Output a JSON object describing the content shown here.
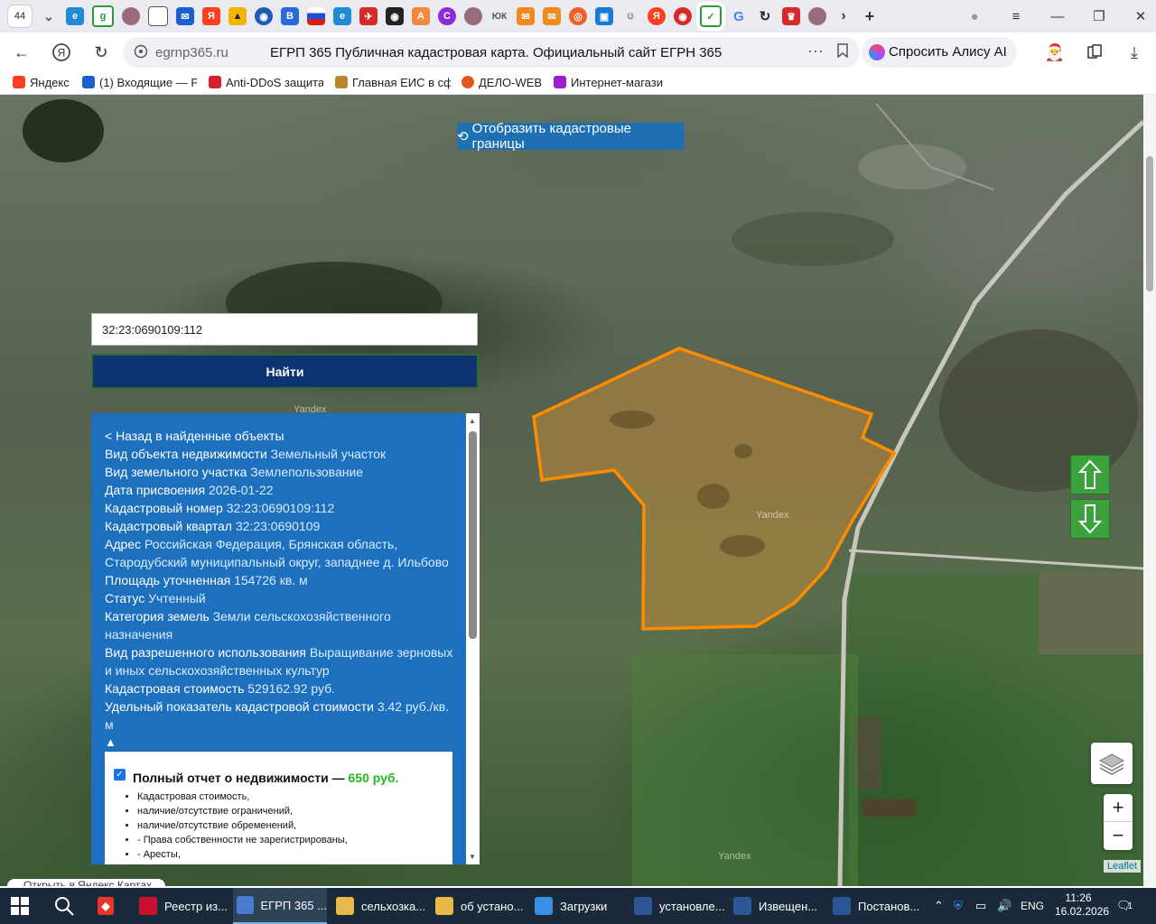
{
  "browser": {
    "tab_count": "44",
    "url_domain": "egrnp365.ru",
    "page_title": "ЕГРП 365 Публичная кадастровая карта. Официальный сайт ЕГРН 365",
    "alice_label": "Спросить Алису AI",
    "bookmarks": [
      {
        "label": "Яндекс",
        "icon": "yandex-icon",
        "color": "#fc3f1d"
      },
      {
        "label": "(1) Входящие — Р",
        "icon": "mail-icon",
        "color": "#1a5fd0"
      },
      {
        "label": "Anti-DDoS защита",
        "icon": "rts-icon",
        "color": "#d4202a"
      },
      {
        "label": "Главная ЕИС в сф",
        "icon": "emblem-icon",
        "color": "#b8862b"
      },
      {
        "label": "ДЕЛО-WEB",
        "icon": "delo-icon",
        "color": "#e05a1f"
      },
      {
        "label": "Интернет-магази",
        "icon": "wb-icon",
        "color": "#a11ad0"
      }
    ]
  },
  "map": {
    "boundaries_button": "Отобразить кадастровые границы",
    "search_value": "32:23:0690109:112",
    "find_button": "Найти",
    "back_link": "< Назад в найденные объекты",
    "properties": [
      {
        "k": "Вид объекта недвижимости",
        "v": "Земельный участок"
      },
      {
        "k": "Вид земельного участка",
        "v": "Землепользование"
      },
      {
        "k": "Дата присвоения",
        "v": "2026-01-22"
      },
      {
        "k": "Кадастровый номер",
        "v": "32:23:0690109:112"
      },
      {
        "k": "Кадастровый квартал",
        "v": "32:23:0690109"
      },
      {
        "k": "Адрес",
        "v": "Российская Федерация, Брянская область, Стародубский муниципальный округ, западнее д. Ильбово"
      },
      {
        "k": "Площадь уточненная",
        "v": "154726 кв. м"
      },
      {
        "k": "Статус",
        "v": "Учтенный"
      },
      {
        "k": "Категория земель",
        "v": "Земли сельскохозяйственного назначения"
      },
      {
        "k": "Вид разрешенного использования",
        "v": "Выращивание зерновых и иных сельскохозяйственных культур"
      },
      {
        "k": "Кадастровая стоимость",
        "v": "529162.92 руб."
      },
      {
        "k": "Удельный показатель кадастровой стоимости",
        "v": "3.42 руб./кв. м"
      }
    ],
    "collapse_glyph": "▲",
    "report": {
      "checked": true,
      "title": "Полный отчет о недвижимости —",
      "price": "650 руб.",
      "items": [
        "Кадастровая стоимость,",
        "наличие/отсутствие ограничений,",
        "наличие/отсутствие обременений,",
        "- Права собственности не зарегистрированы,",
        "- Аресты,"
      ]
    },
    "watermark": "Yandex",
    "attribution": "Leaflet",
    "zoom_in": "+",
    "zoom_out": "−",
    "ymaps_link": "Открыть в Яндекс Картах",
    "parcel_color": "#ff8c00"
  },
  "taskbar": {
    "items": [
      {
        "label": "Реестр из...",
        "icon": "chrome-icon",
        "color": "#c8102e"
      },
      {
        "label": "ЕГРП 365 ...",
        "icon": "yandex-browser-icon",
        "color": "#4a7bd0",
        "active": true
      },
      {
        "label": "сельхозка...",
        "icon": "folder-icon",
        "color": "#e8b84a"
      },
      {
        "label": "об устано...",
        "icon": "folder-icon",
        "color": "#e8b84a"
      },
      {
        "label": "Загрузки",
        "icon": "download-icon",
        "color": "#3a8ee6"
      },
      {
        "label": "установле...",
        "icon": "word-icon",
        "color": "#2b5797"
      },
      {
        "label": "Извещен...",
        "icon": "word-icon",
        "color": "#2b5797"
      },
      {
        "label": "Постанов...",
        "icon": "word-icon",
        "color": "#2b5797"
      }
    ],
    "lang": "ENG",
    "time": "11:26",
    "date": "16.02.2026",
    "notif_count": "1"
  }
}
